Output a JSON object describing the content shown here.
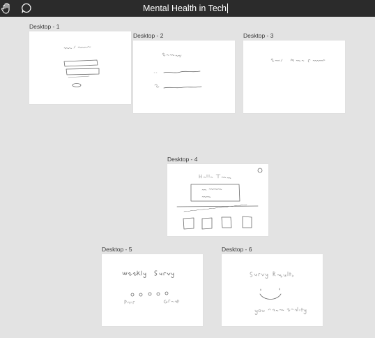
{
  "toolbar": {
    "hand_tool_icon": "hand-icon",
    "comment_tool_icon": "comment-icon"
  },
  "document": {
    "title": "Mental Health in Tech"
  },
  "frames": [
    {
      "label": "Desktop - 1"
    },
    {
      "label": "Desktop - 2"
    },
    {
      "label": "Desktop - 3"
    },
    {
      "label": "Desktop - 4"
    },
    {
      "label": "Desktop - 5"
    },
    {
      "label": "Desktop - 6"
    }
  ],
  "colors": {
    "topbar": "#2b2b2b",
    "canvas": "#e3e3e3",
    "frame": "#ffffff"
  }
}
